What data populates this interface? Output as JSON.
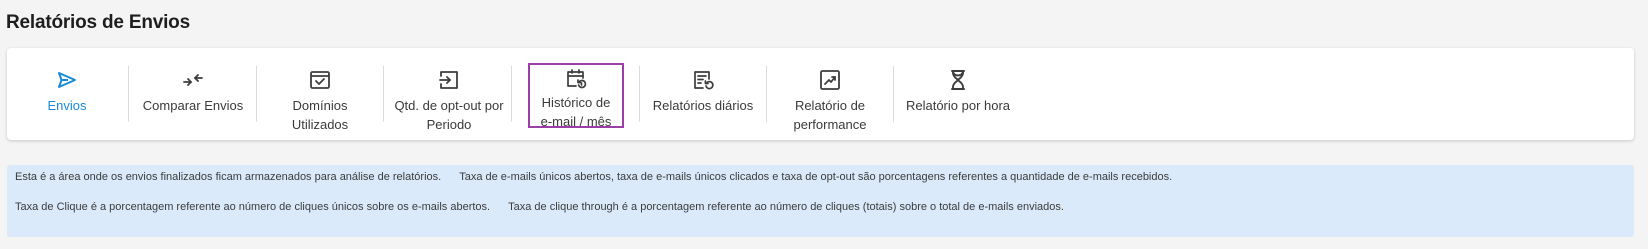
{
  "page": {
    "title": "Relatórios de Envios"
  },
  "tabs": [
    {
      "id": "envios",
      "label": "Envios",
      "icon": "send-icon",
      "active": true
    },
    {
      "id": "comparar",
      "label": "Comparar Envios",
      "icon": "compare-arrows-icon"
    },
    {
      "id": "dominios",
      "label_lines": [
        "Domínios",
        "Utilizados"
      ],
      "icon": "inbox-icon"
    },
    {
      "id": "optout",
      "label_lines": [
        "Qtd. de opt-out por",
        "Periodo"
      ],
      "icon": "login-icon"
    },
    {
      "id": "historico",
      "label_lines": [
        "Histórico de",
        "e-mail / mês"
      ],
      "icon": "calendar-history-icon",
      "selected": true
    },
    {
      "id": "diarios",
      "label": "Relatórios diários",
      "icon": "report-history-icon"
    },
    {
      "id": "performance",
      "label_lines": [
        "Relatório de",
        "performance"
      ],
      "icon": "trending-chart-icon"
    },
    {
      "id": "hora",
      "label": "Relatório por hora",
      "icon": "hourglass-icon"
    }
  ],
  "info": {
    "line1": [
      "Esta é a área onde os envios finalizados ficam armazenados para análise de relatórios.",
      "Taxa de e-mails únicos abertos, taxa de e-mails únicos clicados e taxa de opt-out são porcentagens referentes a quantidade de e-mails recebidos."
    ],
    "line2": [
      "Taxa de Clique é a porcentagem referente ao número de cliques únicos sobre os e-mails abertos.",
      "Taxa de clique through é a porcentagem referente ao número de cliques (totais) sobre o total de e-mails enviados."
    ]
  },
  "colors": {
    "active_tab": "#1a8ad8",
    "selected_outline": "#9b3fa6",
    "info_background": "#dbeafb",
    "icon": "#3d3d3d"
  }
}
